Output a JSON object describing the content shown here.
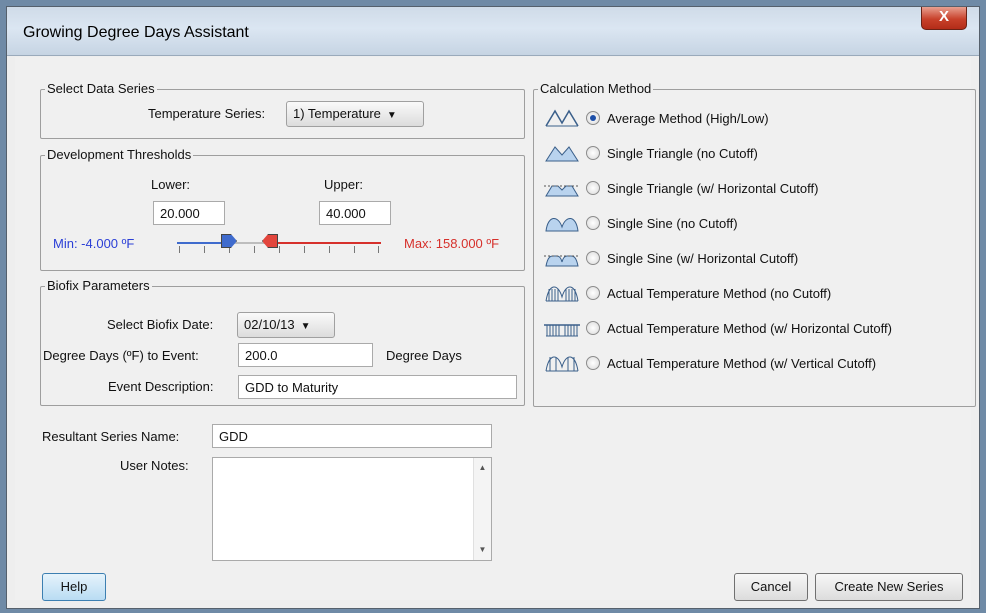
{
  "window": {
    "title": "Growing Degree Days Assistant",
    "close_glyph": "X"
  },
  "data_series": {
    "legend": "Select Data Series",
    "label": "Temperature Series:",
    "value": "1) Temperature"
  },
  "thresholds": {
    "legend": "Development Thresholds",
    "lower_label": "Lower:",
    "upper_label": "Upper:",
    "lower_value": "20.000",
    "upper_value": "40.000",
    "min_label": "Min: -4.000 ºF",
    "max_label": "Max: 158.000 ºF",
    "min_color": "#2b3fd6",
    "max_color": "#d6302b"
  },
  "biofix": {
    "legend": "Biofix Parameters",
    "date_label": "Select Biofix Date:",
    "date_value": "02/10/13",
    "dd_label": "Degree Days (ºF) to Event:",
    "dd_value": "200.0",
    "dd_unit": "Degree Days",
    "desc_label": "Event Description:",
    "desc_value": "GDD to Maturity"
  },
  "result": {
    "name_label": "Resultant Series Name:",
    "name_value": "GDD",
    "notes_label": "User Notes:",
    "notes_value": ""
  },
  "calc": {
    "legend": "Calculation Method",
    "methods": [
      {
        "label": "Average Method (High/Low)",
        "icon": "average-method-icon",
        "selected": true
      },
      {
        "label": "Single Triangle (no Cutoff)",
        "icon": "single-triangle-icon",
        "selected": false
      },
      {
        "label": "Single Triangle (w/ Horizontal Cutoff)",
        "icon": "single-triangle-cutoff-icon",
        "selected": false
      },
      {
        "label": "Single Sine (no Cutoff)",
        "icon": "single-sine-icon",
        "selected": false
      },
      {
        "label": "Single Sine (w/ Horizontal Cutoff)",
        "icon": "single-sine-cutoff-icon",
        "selected": false
      },
      {
        "label": "Actual Temperature Method (no Cutoff)",
        "icon": "actual-temp-icon",
        "selected": false
      },
      {
        "label": "Actual Temperature Method (w/ Horizontal Cutoff)",
        "icon": "actual-temp-horizontal-cutoff-icon",
        "selected": false
      },
      {
        "label": "Actual Temperature Method (w/ Vertical Cutoff)",
        "icon": "actual-temp-vertical-cutoff-icon",
        "selected": false
      }
    ]
  },
  "buttons": {
    "help": "Help",
    "cancel": "Cancel",
    "create": "Create New Series"
  }
}
